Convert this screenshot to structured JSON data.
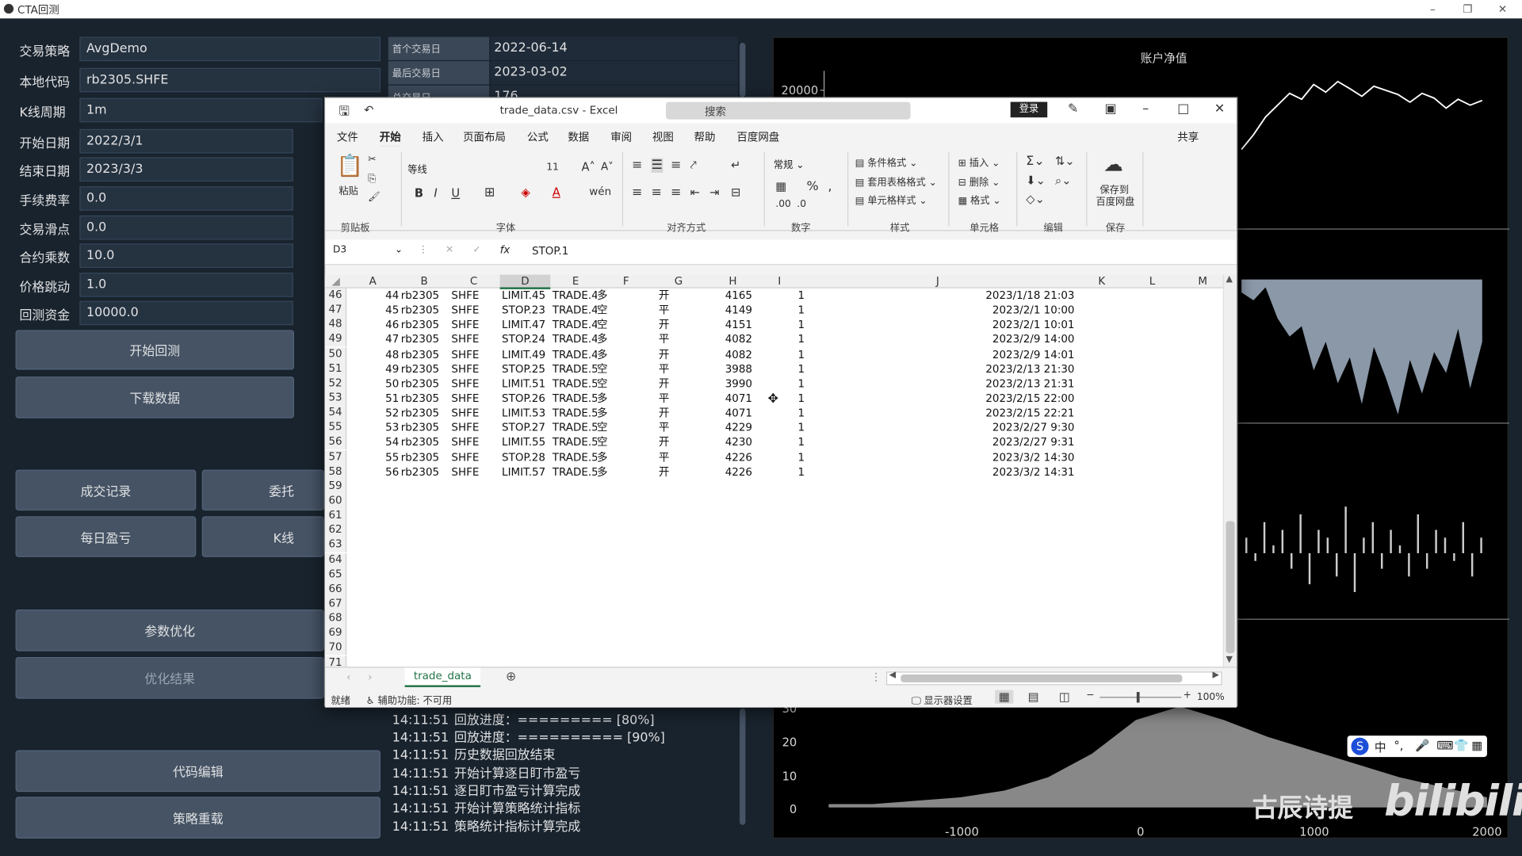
{
  "app": {
    "title": "CTA回测",
    "win_controls": [
      "–",
      "❐",
      "✕"
    ]
  },
  "form": {
    "rows": [
      {
        "label": "交易策略",
        "value": "AvgDemo"
      },
      {
        "label": "本地代码",
        "value": "rb2305.SHFE"
      },
      {
        "label": "K线周期",
        "value": "1m"
      },
      {
        "label": "开始日期",
        "value": "2022/3/1"
      },
      {
        "label": "结束日期",
        "value": "2023/3/3"
      },
      {
        "label": "手续费率",
        "value": "0.0"
      },
      {
        "label": "交易滑点",
        "value": "0.0"
      },
      {
        "label": "合约乘数",
        "value": "10.0"
      },
      {
        "label": "价格跳动",
        "value": "1.0"
      },
      {
        "label": "回测资金",
        "value": "10000.0"
      }
    ]
  },
  "buttons": {
    "start_backtest": "开始回测",
    "download_data": "下载数据",
    "trade_records": "成交记录",
    "order_records": "委托",
    "daily_pnl": "每日盈亏",
    "kline": "K线",
    "param_opt": "参数优化",
    "opt_result": "优化结果",
    "code_edit": "代码编辑",
    "strategy_reload": "策略重载"
  },
  "info": [
    {
      "key": "首个交易日",
      "value": "2022-06-14"
    },
    {
      "key": "最后交易日",
      "value": "2023-03-02"
    },
    {
      "key": "总交易日",
      "value": "176"
    }
  ],
  "log": [
    {
      "time": "14:11:51",
      "msg": "回放进度：========= [80%]"
    },
    {
      "time": "14:11:51",
      "msg": "回放进度：========== [90%]"
    },
    {
      "time": "14:11:51",
      "msg": "历史数据回放结束"
    },
    {
      "time": "14:11:51",
      "msg": "开始计算逐日盯市盈亏"
    },
    {
      "time": "14:11:51",
      "msg": "逐日盯市盈亏计算完成"
    },
    {
      "time": "14:11:51",
      "msg": "开始计算策略统计指标"
    },
    {
      "time": "14:11:51",
      "msg": "策略统计指标计算完成"
    }
  ],
  "chart_data": [
    {
      "type": "line",
      "title": "账户净值",
      "y_tick_labels": [
        "20000"
      ],
      "values": [
        9500,
        12000,
        15000,
        17000,
        19000,
        18000,
        20500,
        19200,
        21000,
        19800,
        18500,
        20200,
        19500,
        18800,
        17500,
        19000,
        18200,
        16500,
        18000,
        17000,
        17800
      ],
      "color": "#ffffff"
    },
    {
      "type": "area",
      "title": "",
      "values": [
        -0.5,
        -0.8,
        -0.3,
        -1.5,
        -2.2,
        -1.8,
        -3.5,
        -2.4,
        -4.0,
        -3.0,
        -4.8,
        -2.6,
        -3.8,
        -5.2,
        -3.1,
        -4.4,
        -2.8,
        -3.6,
        -1.9,
        -4.2,
        -2.4
      ],
      "color": "#8a98a8"
    },
    {
      "type": "bar",
      "title": "",
      "values": [
        2,
        -1,
        4,
        1,
        3,
        -2,
        5,
        -4,
        3,
        2,
        -3,
        6,
        -5,
        2,
        4,
        -2,
        3,
        1,
        -3,
        5,
        -2,
        3,
        2,
        -1,
        4,
        -3,
        2
      ],
      "color": "#cccccc"
    },
    {
      "type": "area",
      "title": "",
      "x_tick_labels": [
        "-1000",
        "0",
        "1000",
        "2000"
      ],
      "y_tick_labels": [
        "0",
        "10",
        "20",
        "30"
      ],
      "xlim": [
        -1800,
        2000
      ],
      "ylim": [
        0,
        30
      ],
      "values": [
        1,
        1,
        2,
        3,
        5,
        9,
        16,
        26,
        30,
        26,
        21,
        17,
        13,
        9,
        6,
        3
      ],
      "color": "#a0a0a0"
    }
  ],
  "excel": {
    "title": "trade_data.csv  -  Excel",
    "search": "搜索",
    "login": "登录",
    "menu": [
      "文件",
      "开始",
      "插入",
      "页面布局",
      "公式",
      "数据",
      "审阅",
      "视图",
      "帮助",
      "百度网盘"
    ],
    "share": "共享",
    "ribbon": {
      "clipboard": "剪贴板",
      "paste": "粘贴",
      "font": "字体",
      "font_name": "等线",
      "font_size": "11",
      "align": "对齐方式",
      "number": "数字",
      "number_format": "常规",
      "styles": "样式",
      "cond_fmt": "条件格式",
      "table_fmt": "套用表格格式",
      "cell_style": "单元格样式",
      "cells": "单元格",
      "insert": "插入",
      "delete": "删除",
      "format": "格式",
      "edit": "编辑",
      "save": "保存",
      "save_to": "保存到",
      "baidu": "百度网盘"
    },
    "name_box": "D3",
    "formula": "STOP.1",
    "columns": [
      "A",
      "B",
      "C",
      "D",
      "E",
      "F",
      "G",
      "H",
      "I",
      "J",
      "K",
      "L",
      "M"
    ],
    "rows": [
      {
        "r": "46",
        "a": "44",
        "b": "rb2305",
        "c": "SHFE",
        "d": "LIMIT.45",
        "e": "TRADE.4",
        "f": "多",
        "g": "开",
        "h": "4165",
        "i": "1",
        "j": "2023/1/18 21:03"
      },
      {
        "r": "47",
        "a": "45",
        "b": "rb2305",
        "c": "SHFE",
        "d": "STOP.23",
        "e": "TRADE.4",
        "f": "空",
        "g": "平",
        "h": "4149",
        "i": "1",
        "j": "2023/2/1 10:00"
      },
      {
        "r": "48",
        "a": "46",
        "b": "rb2305",
        "c": "SHFE",
        "d": "LIMIT.47",
        "e": "TRADE.4",
        "f": "空",
        "g": "开",
        "h": "4151",
        "i": "1",
        "j": "2023/2/1 10:01"
      },
      {
        "r": "49",
        "a": "47",
        "b": "rb2305",
        "c": "SHFE",
        "d": "STOP.24",
        "e": "TRADE.4",
        "f": "多",
        "g": "平",
        "h": "4082",
        "i": "1",
        "j": "2023/2/9 14:00"
      },
      {
        "r": "50",
        "a": "48",
        "b": "rb2305",
        "c": "SHFE",
        "d": "LIMIT.49",
        "e": "TRADE.4",
        "f": "多",
        "g": "开",
        "h": "4082",
        "i": "1",
        "j": "2023/2/9 14:01"
      },
      {
        "r": "51",
        "a": "49",
        "b": "rb2305",
        "c": "SHFE",
        "d": "STOP.25",
        "e": "TRADE.5",
        "f": "空",
        "g": "平",
        "h": "3988",
        "i": "1",
        "j": "2023/2/13 21:30"
      },
      {
        "r": "52",
        "a": "50",
        "b": "rb2305",
        "c": "SHFE",
        "d": "LIMIT.51",
        "e": "TRADE.5",
        "f": "空",
        "g": "开",
        "h": "3990",
        "i": "1",
        "j": "2023/2/13 21:31"
      },
      {
        "r": "53",
        "a": "51",
        "b": "rb2305",
        "c": "SHFE",
        "d": "STOP.26",
        "e": "TRADE.5",
        "f": "多",
        "g": "平",
        "h": "4071",
        "i": "1",
        "j": "2023/2/15 22:00"
      },
      {
        "r": "54",
        "a": "52",
        "b": "rb2305",
        "c": "SHFE",
        "d": "LIMIT.53",
        "e": "TRADE.5",
        "f": "多",
        "g": "开",
        "h": "4071",
        "i": "1",
        "j": "2023/2/15 22:21"
      },
      {
        "r": "55",
        "a": "53",
        "b": "rb2305",
        "c": "SHFE",
        "d": "STOP.27",
        "e": "TRADE.5",
        "f": "空",
        "g": "平",
        "h": "4229",
        "i": "1",
        "j": "2023/2/27 9:30"
      },
      {
        "r": "56",
        "a": "54",
        "b": "rb2305",
        "c": "SHFE",
        "d": "LIMIT.55",
        "e": "TRADE.5",
        "f": "空",
        "g": "开",
        "h": "4230",
        "i": "1",
        "j": "2023/2/27 9:31"
      },
      {
        "r": "57",
        "a": "55",
        "b": "rb2305",
        "c": "SHFE",
        "d": "STOP.28",
        "e": "TRADE.5",
        "f": "多",
        "g": "平",
        "h": "4226",
        "i": "1",
        "j": "2023/3/2 14:30"
      },
      {
        "r": "58",
        "a": "56",
        "b": "rb2305",
        "c": "SHFE",
        "d": "LIMIT.57",
        "e": "TRADE.5",
        "f": "多",
        "g": "开",
        "h": "4226",
        "i": "1",
        "j": "2023/3/2 14:31"
      }
    ],
    "empty_rows": [
      "59",
      "60",
      "61",
      "62",
      "63",
      "64",
      "65",
      "66",
      "67",
      "68",
      "69",
      "70",
      "71"
    ],
    "sheet_tab": "trade_data",
    "status_ready": "就绪",
    "accessibility": "辅助功能: 不可用",
    "display_settings": "显示器设置",
    "zoom": "100%"
  },
  "watermark": {
    "author": "古辰诗提",
    "site": "bilibili"
  },
  "ime": {
    "lang": "中"
  }
}
